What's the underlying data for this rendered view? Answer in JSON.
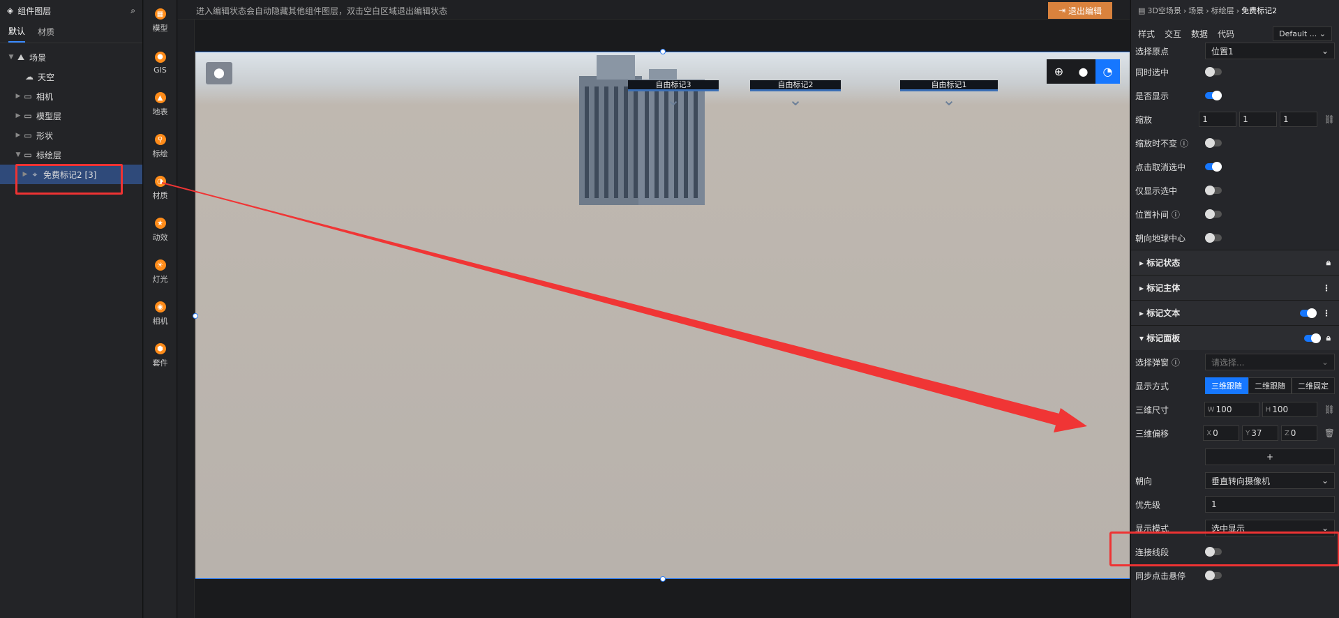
{
  "layers": {
    "title": "组件图层",
    "tabs": [
      "默认",
      "材质"
    ],
    "tree": [
      {
        "label": "场景",
        "icon": "scene-icon",
        "expanded": true
      },
      {
        "label": "天空",
        "icon": "sky-icon"
      },
      {
        "label": "相机",
        "icon": "folder-icon"
      },
      {
        "label": "模型层",
        "icon": "folder-icon"
      },
      {
        "label": "形状",
        "icon": "folder-icon"
      },
      {
        "label": "标绘层",
        "icon": "folder-icon",
        "expanded": true
      },
      {
        "label": "免费标记2 [3]",
        "icon": "marker-icon",
        "selected": true
      }
    ]
  },
  "toolbar": {
    "items": [
      "模型",
      "GIS",
      "地表",
      "标绘",
      "材质",
      "动效",
      "灯光",
      "相机",
      "套件"
    ]
  },
  "stage": {
    "tip": "进入编辑状态会自动隐藏其他组件图层，双击空白区域退出编辑状态",
    "exit_label": "退出编辑",
    "markers": [
      "自由标记3",
      "自由标记2",
      "自由标记1"
    ]
  },
  "props": {
    "breadcrumb": [
      "3D空场景",
      "场景",
      "标绘层",
      "免费标记2"
    ],
    "tabs": [
      "样式",
      "交互",
      "数据",
      "代码"
    ],
    "theme_select": "Default ...",
    "origin_label": "选择原点",
    "origin_value": "位置1",
    "toggles1": [
      {
        "label": "同时选中",
        "on": false
      },
      {
        "label": "是否显示",
        "on": true
      }
    ],
    "scale_label": "缩放",
    "scale_values": [
      "1",
      "1",
      "1"
    ],
    "toggles2": [
      {
        "label": "缩放时不变",
        "on": false,
        "help": true
      },
      {
        "label": "点击取消选中",
        "on": true
      },
      {
        "label": "仅显示选中",
        "on": false
      },
      {
        "label": "位置补间",
        "on": false,
        "help": true
      },
      {
        "label": "朝向地球中心",
        "on": false
      }
    ],
    "sections": [
      "标记状态",
      "标记主体",
      "标记文本",
      "标记面板"
    ],
    "popup_label": "选择弹窗",
    "popup_placeholder": "请选择...",
    "display_label": "显示方式",
    "display_options": [
      "三维跟随",
      "二维跟随",
      "二维固定"
    ],
    "size_label": "三维尺寸",
    "size_w": "100",
    "size_h": "100",
    "offset_label": "三维偏移",
    "offset_x": "0",
    "offset_y": "37",
    "offset_z": "0",
    "add_label": "+",
    "facing_label": "朝向",
    "facing_value": "垂直转向摄像机",
    "priority_label": "优先级",
    "priority_value": "1",
    "mode_label": "显示模式",
    "mode_value": "选中显示",
    "line_label": "连接线段",
    "sync_label": "同步点击悬停",
    "tag_w": "W",
    "tag_h": "H",
    "tag_x": "X",
    "tag_y": "Y",
    "tag_z": "Z"
  },
  "colors": {
    "accent": "#1677ff",
    "highlight": "#ee3333",
    "exit": "#d9823d"
  }
}
